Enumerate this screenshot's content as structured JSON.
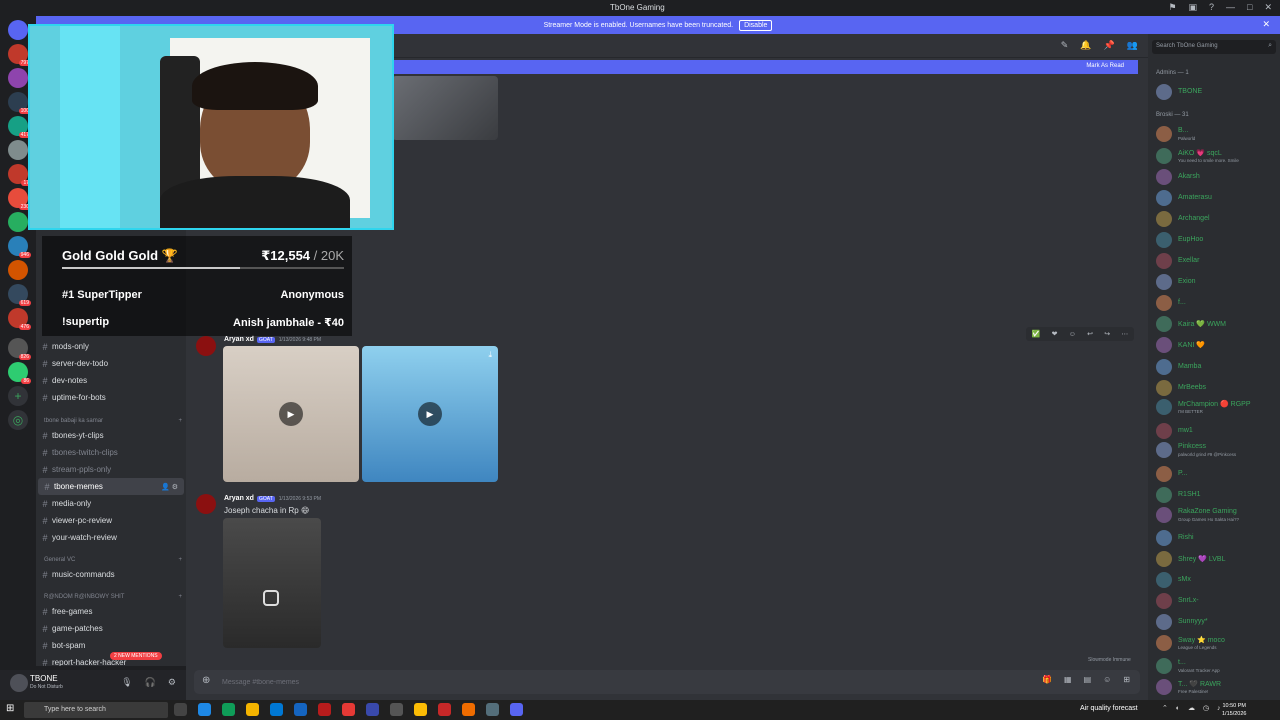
{
  "window": {
    "title": "TbOne Gaming"
  },
  "banner": {
    "text": "Streamer Mode is enabled. Usernames have been truncated.",
    "disable_label": "Disable"
  },
  "search": {
    "placeholder": "Search TbOne Gaming"
  },
  "unread": {
    "mark_as_read": "Mark As Read"
  },
  "overlay": {
    "goal_title": "Gold Gold Gold 🏆",
    "goal_amount": "₹12,554",
    "goal_target": " / 20K",
    "goal_progress": 0.63,
    "top_label": "#1 SuperTipper",
    "top_name": "Anonymous",
    "cmd_label": "!supertip",
    "last_tip": "Anish jambhale - ₹40"
  },
  "channels": {
    "items_top": [
      "mods-only",
      "server-dev-todo",
      "dev-notes",
      "uptime-for-bots"
    ],
    "cat1": "tbone babaji ka samar",
    "items_mid": [
      "tbones-yt-clips",
      "tbones-twitch-clips",
      "stream-ppls-only",
      "tbone-memes",
      "media-only",
      "viewer-pc-review",
      "your-watch-review"
    ],
    "cat2": "General VC",
    "items_vc": [
      "music-commands"
    ],
    "cat3": "R@NDOM R@INBOWY SHIT",
    "items_bottom": [
      "free-games",
      "game-patches",
      "bot-spam",
      "report-hacker-hacker"
    ],
    "mentions": "2 NEW MENTIONS"
  },
  "user": {
    "name": "TBONE",
    "status": "Do Not Disturb"
  },
  "messages": [
    {
      "author": "Aryan xd",
      "tag": "GOAT",
      "time": "1/13/2026 9:48 PM"
    },
    {
      "author": "Aryan xd",
      "tag": "GOAT",
      "time": "1/13/2026 9:53 PM",
      "text": "Joseph chacha in Rp 😄"
    }
  ],
  "composer": {
    "placeholder": "Message #tbone-memes"
  },
  "slowmode": "Slowmode Immune",
  "members": {
    "admins_header": "Admins — 1",
    "broski_header": "Broski — 31",
    "list": [
      {
        "name": "TBONE",
        "sub": ""
      },
      {
        "name": "B...",
        "sub": "Palworld"
      },
      {
        "name": "AiKO 💗 sqcL",
        "sub": "You need to smile more. Smile"
      },
      {
        "name": "Akarsh",
        "sub": ""
      },
      {
        "name": "Amaterasu",
        "sub": ""
      },
      {
        "name": "Archangel",
        "sub": ""
      },
      {
        "name": "EupHoo",
        "sub": ""
      },
      {
        "name": "Exellar",
        "sub": ""
      },
      {
        "name": "Exion",
        "sub": ""
      },
      {
        "name": "f...",
        "sub": ""
      },
      {
        "name": "Kaira 💚 WWM",
        "sub": ""
      },
      {
        "name": "KANI 🧡",
        "sub": ""
      },
      {
        "name": "Mamba",
        "sub": ""
      },
      {
        "name": "MrBeebs",
        "sub": ""
      },
      {
        "name": "MrChampion 🔴 RGPP",
        "sub": "I'M BETTER"
      },
      {
        "name": "mw1",
        "sub": ""
      },
      {
        "name": "Pinkcess",
        "sub": "palworld grind #9 @Pinkcess"
      },
      {
        "name": "P...",
        "sub": ""
      },
      {
        "name": "R1SH1",
        "sub": ""
      },
      {
        "name": "RakaZone Gaming",
        "sub": "Group Games Ho Sakta Hai??"
      },
      {
        "name": "Rishi",
        "sub": ""
      },
      {
        "name": "Shrey 💜 LVBL",
        "sub": ""
      },
      {
        "name": "sMx",
        "sub": ""
      },
      {
        "name": "SnrLx-",
        "sub": ""
      },
      {
        "name": "Sunnyyy*",
        "sub": ""
      },
      {
        "name": "Sway ⭐ moco",
        "sub": "League of Legends"
      },
      {
        "name": "t...",
        "sub": "Valorant Tracker App"
      },
      {
        "name": "T... 🖤 RAWR",
        "sub": "Free Palestine!"
      }
    ]
  },
  "taskbar": {
    "search_placeholder": "Type here to search",
    "weather": "Air quality forecast",
    "time": "10:50 PM",
    "date": "1/15/2026"
  }
}
